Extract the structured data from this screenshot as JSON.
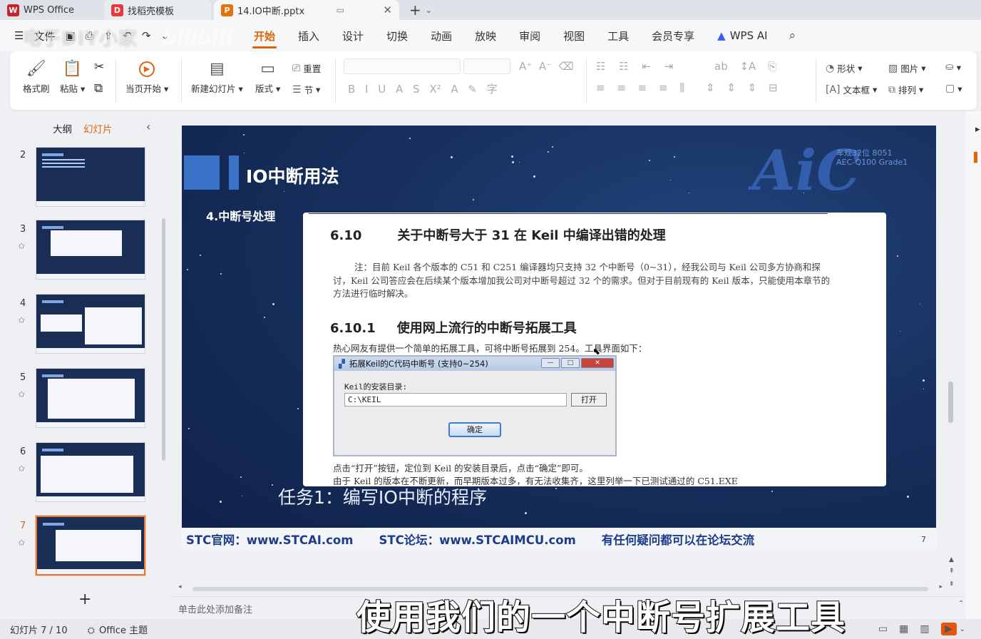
{
  "tabs": [
    {
      "label": "WPS Office",
      "logo": "W"
    },
    {
      "label": "找稻壳模板",
      "logo": "D"
    },
    {
      "label": "14.IO中断.pptx",
      "logo": "P"
    }
  ],
  "menu": {
    "file": "文件",
    "tabs": [
      "开始",
      "插入",
      "设计",
      "切换",
      "动画",
      "放映",
      "审阅",
      "视图",
      "工具",
      "会员专享"
    ],
    "active": "开始",
    "ai": "WPS AI"
  },
  "ribbon": {
    "format_painter": "格式刷",
    "paste": "粘贴",
    "from_current": "当页开始",
    "new_slide": "新建幻灯片",
    "layout": "版式",
    "reset": "重置",
    "section": "节",
    "shape": "形状",
    "picture": "图片",
    "textbox": "文本框",
    "arrange": "排列"
  },
  "left_panel": {
    "outline": "大纲",
    "slides": "幻灯片",
    "thumbnails": [
      {
        "num": "2"
      },
      {
        "num": "3"
      },
      {
        "num": "4"
      },
      {
        "num": "5"
      },
      {
        "num": "6"
      },
      {
        "num": "7"
      }
    ],
    "add": "+"
  },
  "slide": {
    "title": "IO中断用法",
    "subtitle": "4.中断号处理",
    "logo": "AiC",
    "logo_sub1": "车规32位 8051",
    "logo_sub2": "AEC-Q100 Grade1",
    "doc": {
      "h1_num": "6.10",
      "h1_text": "关于中断号大于 31 在 Keil 中编译出错的处理",
      "note": "注：目前 Keil 各个版本的 C51 和 C251 编译器均只支持 32 个中断号（0~31），经我公司与 Keil 公司多方协商和探讨，Keil 公司答应会在后续某个版本增加我公司对中断号超过 32 个的需求。但对于目前现有的 Keil 版本，只能使用本章节的方法进行临时解决。",
      "h2_num": "6.10.1",
      "h2_text": "使用网上流行的中断号拓展工具",
      "p1": "热心网友有提供一个简单的拓展工具，可将中断号拓展到 254。工具界面如下：",
      "window": {
        "title": "拓展Keil的C代码中断号 (支持0~254)",
        "label": "Keil的安装目录:",
        "path": "C:\\KEIL",
        "open": "打开",
        "ok": "确定"
      },
      "p2": "点击“打开”按钮，定位到 Keil 的安装目录后，点击“确定”即可。",
      "p3": "由于 Keil 的版本在不断更新，而早期版本过多，有无法收集齐，这里列举一下已测试通过的 C51.EXE"
    },
    "task": "任务1：编写IO中断的程序",
    "footer": [
      "STC官网：www.STCAI.com",
      "STC论坛：www.STCAIMCU.com",
      "有任何疑问都可以在论坛交流"
    ],
    "page": "7"
  },
  "notes_placeholder": "单击此处添加备注",
  "status": {
    "slide_info": "幻灯片 7 / 10",
    "theme": "Office 主题"
  },
  "overlay": {
    "watermark": "电子DIY小家",
    "watermark2": "bilibili",
    "caption": "使用我们的一个中断号扩展工具"
  },
  "colors": {
    "accent": "#e0630e",
    "slide_bg": "#17305e",
    "title_block": "#3a72c8"
  }
}
